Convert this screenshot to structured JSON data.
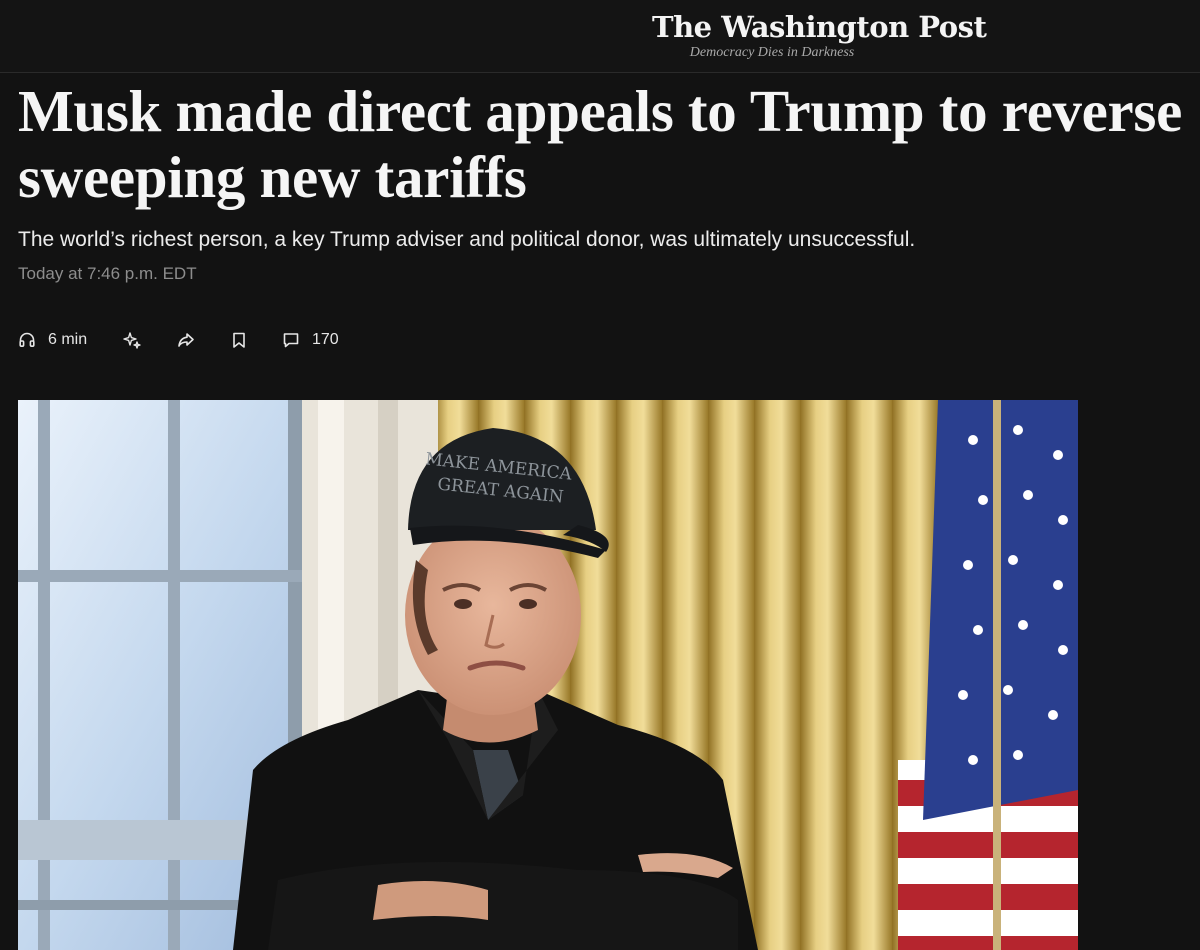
{
  "masthead": {
    "logo_name": "The Washington Post",
    "tagline": "Democracy Dies in Darkness"
  },
  "article": {
    "headline": "Musk made direct appeals to Trump to reverse sweeping new tariffs",
    "dek": "The world’s richest person, a key Trump adviser and political donor, was ultimately unsuccessful.",
    "timestamp": "Today at 7:46 p.m. EDT"
  },
  "toolbar": {
    "listen_icon": "headphones-icon",
    "listen_label": "6 min",
    "ai_icon": "sparkle-icon",
    "share_icon": "share-icon",
    "save_icon": "bookmark-icon",
    "comments_icon": "comment-icon",
    "comments_count": "170"
  },
  "photo": {
    "cap_text_line1": "MAKE AMERICA",
    "cap_text_line2": "GREAT AGAIN",
    "colors": {
      "curtain": "#c9a74a",
      "window": "#dbe8f5",
      "coat": "#111111",
      "flag_blue": "#2a3f8f",
      "flag_red": "#b5252e"
    }
  },
  "colors": {
    "background": "#121212",
    "text": "#f5f5f5",
    "muted": "#8d8d8d"
  }
}
